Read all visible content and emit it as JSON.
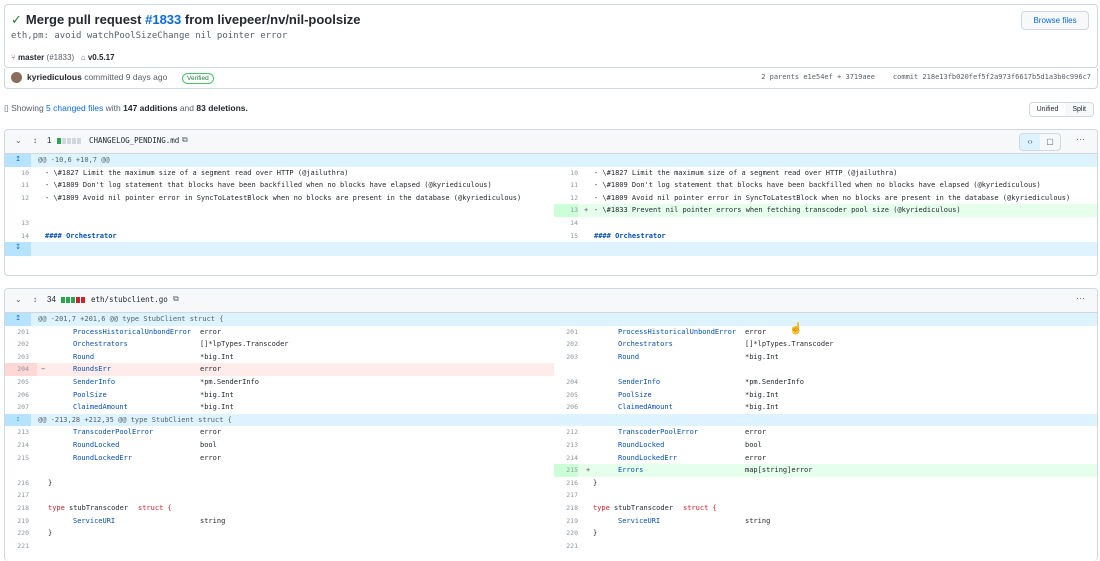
{
  "commit": {
    "title_prefix": "Merge pull request",
    "pr_number": "#1833",
    "title_suffix": "from livepeer/nv/nil-poolsize",
    "message": "eth,pm: avoid watchPoolSizeChange nil pointer error",
    "browse_label": "Browse files",
    "branch": "master",
    "branch_pr": "(#1833)",
    "tag": "v0.5.17",
    "author": "kyriediculous",
    "committed_text": "committed 9 days ago",
    "verified": "Verified",
    "parents_text": "2 parents  e1e54ef + 3719aee",
    "commit_text": "commit 218e13fb020fef5f2a973f6617b5d1a3b0c996c7"
  },
  "summary": {
    "prefix": "Showing",
    "changed": "5 changed files",
    "with": "with",
    "additions": "147 additions",
    "and": "and",
    "deletions": "83 deletions."
  },
  "view_toggle": {
    "unified": "Unified",
    "split": "Split"
  },
  "files": [
    {
      "count": "1",
      "name": "CHANGELOG_PENDING.md",
      "hunk": "@@ -10,6 +10,7 @@",
      "rows": [
        {
          "ln": "10",
          "lcode": "- \\#1827 Limit the maximum size of a segment read over HTTP (@jailuthra)",
          "rn": "10",
          "rcode": "- \\#1827 Limit the maximum size of a segment read over HTTP (@jailuthra)"
        },
        {
          "ln": "11",
          "lcode": "- \\#1809 Don't log statement that blocks have been backfilled when no blocks have elapsed (@kyriediculous)",
          "rn": "11",
          "rcode": "- \\#1809 Don't log statement that blocks have been backfilled when no blocks have elapsed (@kyriediculous)"
        },
        {
          "ln": "12",
          "lcode": "- \\#1809 Avoid nil pointer error in SyncToLatestBlock when no blocks are present in the database (@kyriediculous)",
          "rn": "12",
          "rcode": "- \\#1809 Avoid nil pointer error in SyncToLatestBlock when no blocks are present in the database (@kyriediculous)"
        },
        {
          "ln": "",
          "lcode": "",
          "rn": "13",
          "rcode": "- \\#1833 Prevent nil pointer errors when fetching transcoder pool size (@kyriediculous)",
          "rsign": "+"
        },
        {
          "ln": "13",
          "lcode": "",
          "rn": "14",
          "rcode": ""
        },
        {
          "ln": "14",
          "lcode": "#### Orchestrator",
          "rn": "15",
          "rcode": "#### Orchestrator"
        }
      ]
    },
    {
      "count": "34",
      "name": "eth/stubclient.go",
      "hunk1": "@@ -201,7 +201,6 @@ type StubClient struct {",
      "hunk2": "@@ -213,28 +212,35 @@ type StubClient struct {",
      "rows1": [
        {
          "ln": "201",
          "field": "ProcessHistoricalUnbondError",
          "type": "error",
          "rn": "201",
          "rfield": "ProcessHistoricalUnbondError",
          "rtype": "error"
        },
        {
          "ln": "202",
          "field": "Orchestrators",
          "type": "[]*lpTypes.Transcoder",
          "rn": "202",
          "rfield": "Orchestrators",
          "rtype": "[]*lpTypes.Transcoder"
        },
        {
          "ln": "203",
          "field": "Round",
          "type": "*big.Int",
          "rn": "203",
          "rfield": "Round",
          "rtype": "*big.Int"
        },
        {
          "ln": "204",
          "field": "RoundsErr",
          "type": "error",
          "rn": "",
          "rfield": "",
          "rtype": "",
          "del": true
        },
        {
          "ln": "205",
          "field": "SenderInfo",
          "type": "*pm.SenderInfo",
          "rn": "204",
          "rfield": "SenderInfo",
          "rtype": "*pm.SenderInfo"
        },
        {
          "ln": "206",
          "field": "PoolSize",
          "type": "*big.Int",
          "rn": "205",
          "rfield": "PoolSize",
          "rtype": "*big.Int"
        },
        {
          "ln": "207",
          "field": "ClaimedAmount",
          "type": "*big.Int",
          "rn": "206",
          "rfield": "ClaimedAmount",
          "rtype": "*big.Int"
        }
      ],
      "rows2": [
        {
          "ln": "213",
          "field": "TranscoderPoolError",
          "type": "error",
          "rn": "212",
          "rfield": "TranscoderPoolError",
          "rtype": "error"
        },
        {
          "ln": "214",
          "field": "RoundLocked",
          "type": "bool",
          "rn": "213",
          "rfield": "RoundLocked",
          "rtype": "bool"
        },
        {
          "ln": "215",
          "field": "RoundLockedErr",
          "type": "error",
          "rn": "214",
          "rfield": "RoundLockedErr",
          "rtype": "error"
        },
        {
          "ln": "",
          "field": "",
          "type": "",
          "rn": "215",
          "rfield": "Errors",
          "rtype": "map[string]error",
          "add": true
        },
        {
          "ln": "216",
          "brace": "}",
          "rn": "216",
          "rbrace": "}"
        },
        {
          "ln": "217",
          "brace": "",
          "rn": "217",
          "rbrace": ""
        },
        {
          "ln": "218",
          "kw": "type",
          "name": "stubTranscoder",
          "kw2": "struct {",
          "rn": "218"
        },
        {
          "ln": "219",
          "field": "ServiceURI",
          "type": "string",
          "rn": "219",
          "rfield": "ServiceURI",
          "rtype": "string"
        },
        {
          "ln": "220",
          "brace": "}",
          "rn": "220",
          "rbrace": "}"
        },
        {
          "ln": "221",
          "brace": "",
          "rn": "221",
          "rbrace": ""
        }
      ]
    }
  ]
}
